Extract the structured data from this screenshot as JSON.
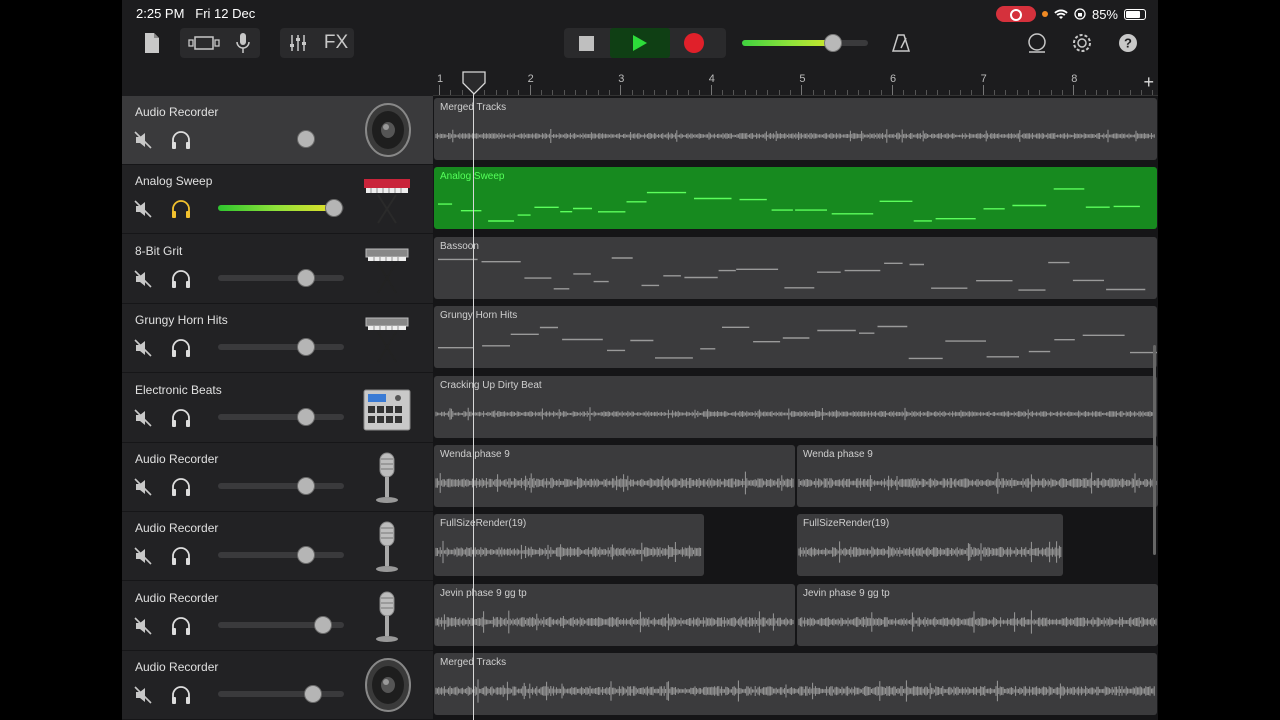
{
  "status_bar": {
    "time": "2:25 PM",
    "date": "Fri 12 Dec",
    "battery": "85%"
  },
  "toolbar": {
    "fx_label": "FX",
    "master_volume": 0.65,
    "icons": [
      "document-icon",
      "view-toggle-icon",
      "microphone-icon",
      "mixer-icon",
      "stop-icon",
      "play-icon",
      "record-icon",
      "metronome-icon",
      "loop-icon",
      "settings-icon",
      "help-icon"
    ]
  },
  "ruler": {
    "bars": [
      "1",
      "2",
      "3",
      "4",
      "5",
      "6",
      "7",
      "8"
    ],
    "add_label": "+"
  },
  "tracks": [
    {
      "name": "Audio Recorder",
      "volume": 0.7,
      "selected": true,
      "solo_color": "#dddddd",
      "icon": "speaker-icon",
      "regions": [
        {
          "label": "Merged Tracks",
          "start": 0,
          "end": 1,
          "kind": "audio",
          "color": "#3b3b3d"
        }
      ]
    },
    {
      "name": "Analog Sweep",
      "volume": 0.92,
      "selected": false,
      "solo_color": "#f2c12e",
      "icon": "synth-keyboard-icon",
      "regions": [
        {
          "label": "Analog Sweep",
          "start": 0,
          "end": 1,
          "kind": "midi",
          "color": "#178a1f"
        }
      ]
    },
    {
      "name": "8-Bit Grit",
      "volume": 0.7,
      "selected": false,
      "solo_color": "#dddddd",
      "icon": "keyboard-stand-icon",
      "regions": [
        {
          "label": "Bassoon",
          "start": 0,
          "end": 1,
          "kind": "midi",
          "color": "#3b3b3d"
        }
      ]
    },
    {
      "name": "Grungy Horn Hits",
      "volume": 0.7,
      "selected": false,
      "solo_color": "#dddddd",
      "icon": "keyboard-stand-icon",
      "regions": [
        {
          "label": "Grungy Horn Hits",
          "start": 0,
          "end": 1,
          "kind": "midi",
          "color": "#3b3b3d"
        }
      ]
    },
    {
      "name": "Electronic Beats",
      "volume": 0.7,
      "selected": false,
      "solo_color": "#dddddd",
      "icon": "drum-machine-icon",
      "regions": [
        {
          "label": "Cracking Up Dirty Beat",
          "start": 0,
          "end": 1,
          "kind": "beat",
          "color": "#3b3b3d"
        }
      ]
    },
    {
      "name": "Audio Recorder",
      "volume": 0.7,
      "selected": false,
      "solo_color": "#dddddd",
      "icon": "microphone-icon",
      "regions": [
        {
          "label": "Wenda phase 9",
          "start": 0,
          "end": 0.5,
          "kind": "audio",
          "color": "#3b3b3d"
        },
        {
          "label": "Wenda phase 9",
          "start": 0.5,
          "end": 1,
          "kind": "audio",
          "color": "#3b3b3d"
        }
      ]
    },
    {
      "name": "Audio Recorder",
      "volume": 0.7,
      "selected": false,
      "solo_color": "#dddddd",
      "icon": "microphone-icon",
      "regions": [
        {
          "label": "FullSizeRender(19)",
          "start": 0,
          "end": 0.375,
          "kind": "audio",
          "color": "#3b3b3d"
        },
        {
          "label": "FullSizeRender(19)",
          "start": 0.5,
          "end": 0.87,
          "kind": "audio",
          "color": "#3b3b3d"
        }
      ]
    },
    {
      "name": "Audio Recorder",
      "volume": 0.83,
      "selected": false,
      "solo_color": "#dddddd",
      "icon": "microphone-icon",
      "regions": [
        {
          "label": "Jevin phase 9 gg tp",
          "start": 0,
          "end": 0.5,
          "kind": "audio",
          "color": "#3b3b3d"
        },
        {
          "label": "Jevin phase 9 gg tp",
          "start": 0.5,
          "end": 1,
          "kind": "audio",
          "color": "#3b3b3d"
        }
      ]
    },
    {
      "name": "Audio Recorder",
      "volume": 0.75,
      "selected": false,
      "solo_color": "#dddddd",
      "icon": "speaker-icon",
      "regions": [
        {
          "label": "Merged Tracks",
          "start": 0,
          "end": 1,
          "kind": "audio",
          "color": "#3b3b3d"
        }
      ]
    }
  ]
}
